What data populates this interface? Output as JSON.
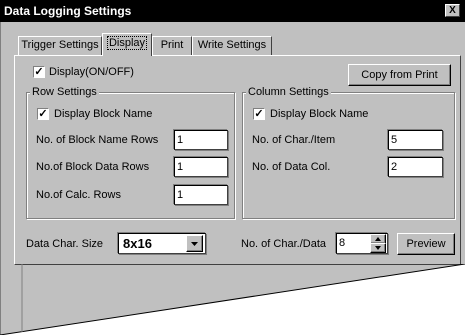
{
  "window": {
    "title": "Data Logging Settings",
    "close_glyph": "X"
  },
  "tabs": [
    {
      "label": "Trigger Settings",
      "active": false
    },
    {
      "label": "Display",
      "active": true
    },
    {
      "label": "Print",
      "active": false
    },
    {
      "label": "Write Settings",
      "active": false
    }
  ],
  "display_toggle": {
    "label": "Display(ON/OFF)",
    "checked": true
  },
  "copy_button": {
    "label": "Copy from Print"
  },
  "row_settings": {
    "title": "Row Settings",
    "display_block_name": {
      "label": "Display Block Name",
      "checked": true
    },
    "block_name_rows": {
      "label": "No. of Block Name Rows",
      "value": "1"
    },
    "block_data_rows": {
      "label": "No.of Block Data Rows",
      "value": "1"
    },
    "calc_rows": {
      "label": "No.of Calc. Rows",
      "value": "1"
    }
  },
  "column_settings": {
    "title": "Column Settings",
    "display_block_name": {
      "label": "Display Block Name",
      "checked": true
    },
    "char_per_item": {
      "label": "No. of Char./Item",
      "value": "5"
    },
    "data_col": {
      "label": "No. of Data Col.",
      "value": "2"
    }
  },
  "data_char_size": {
    "label": "Data Char. Size",
    "value": "8x16"
  },
  "char_per_data": {
    "label": "No. of Char./Data",
    "value": "8"
  },
  "preview_button": {
    "label": "Preview"
  }
}
